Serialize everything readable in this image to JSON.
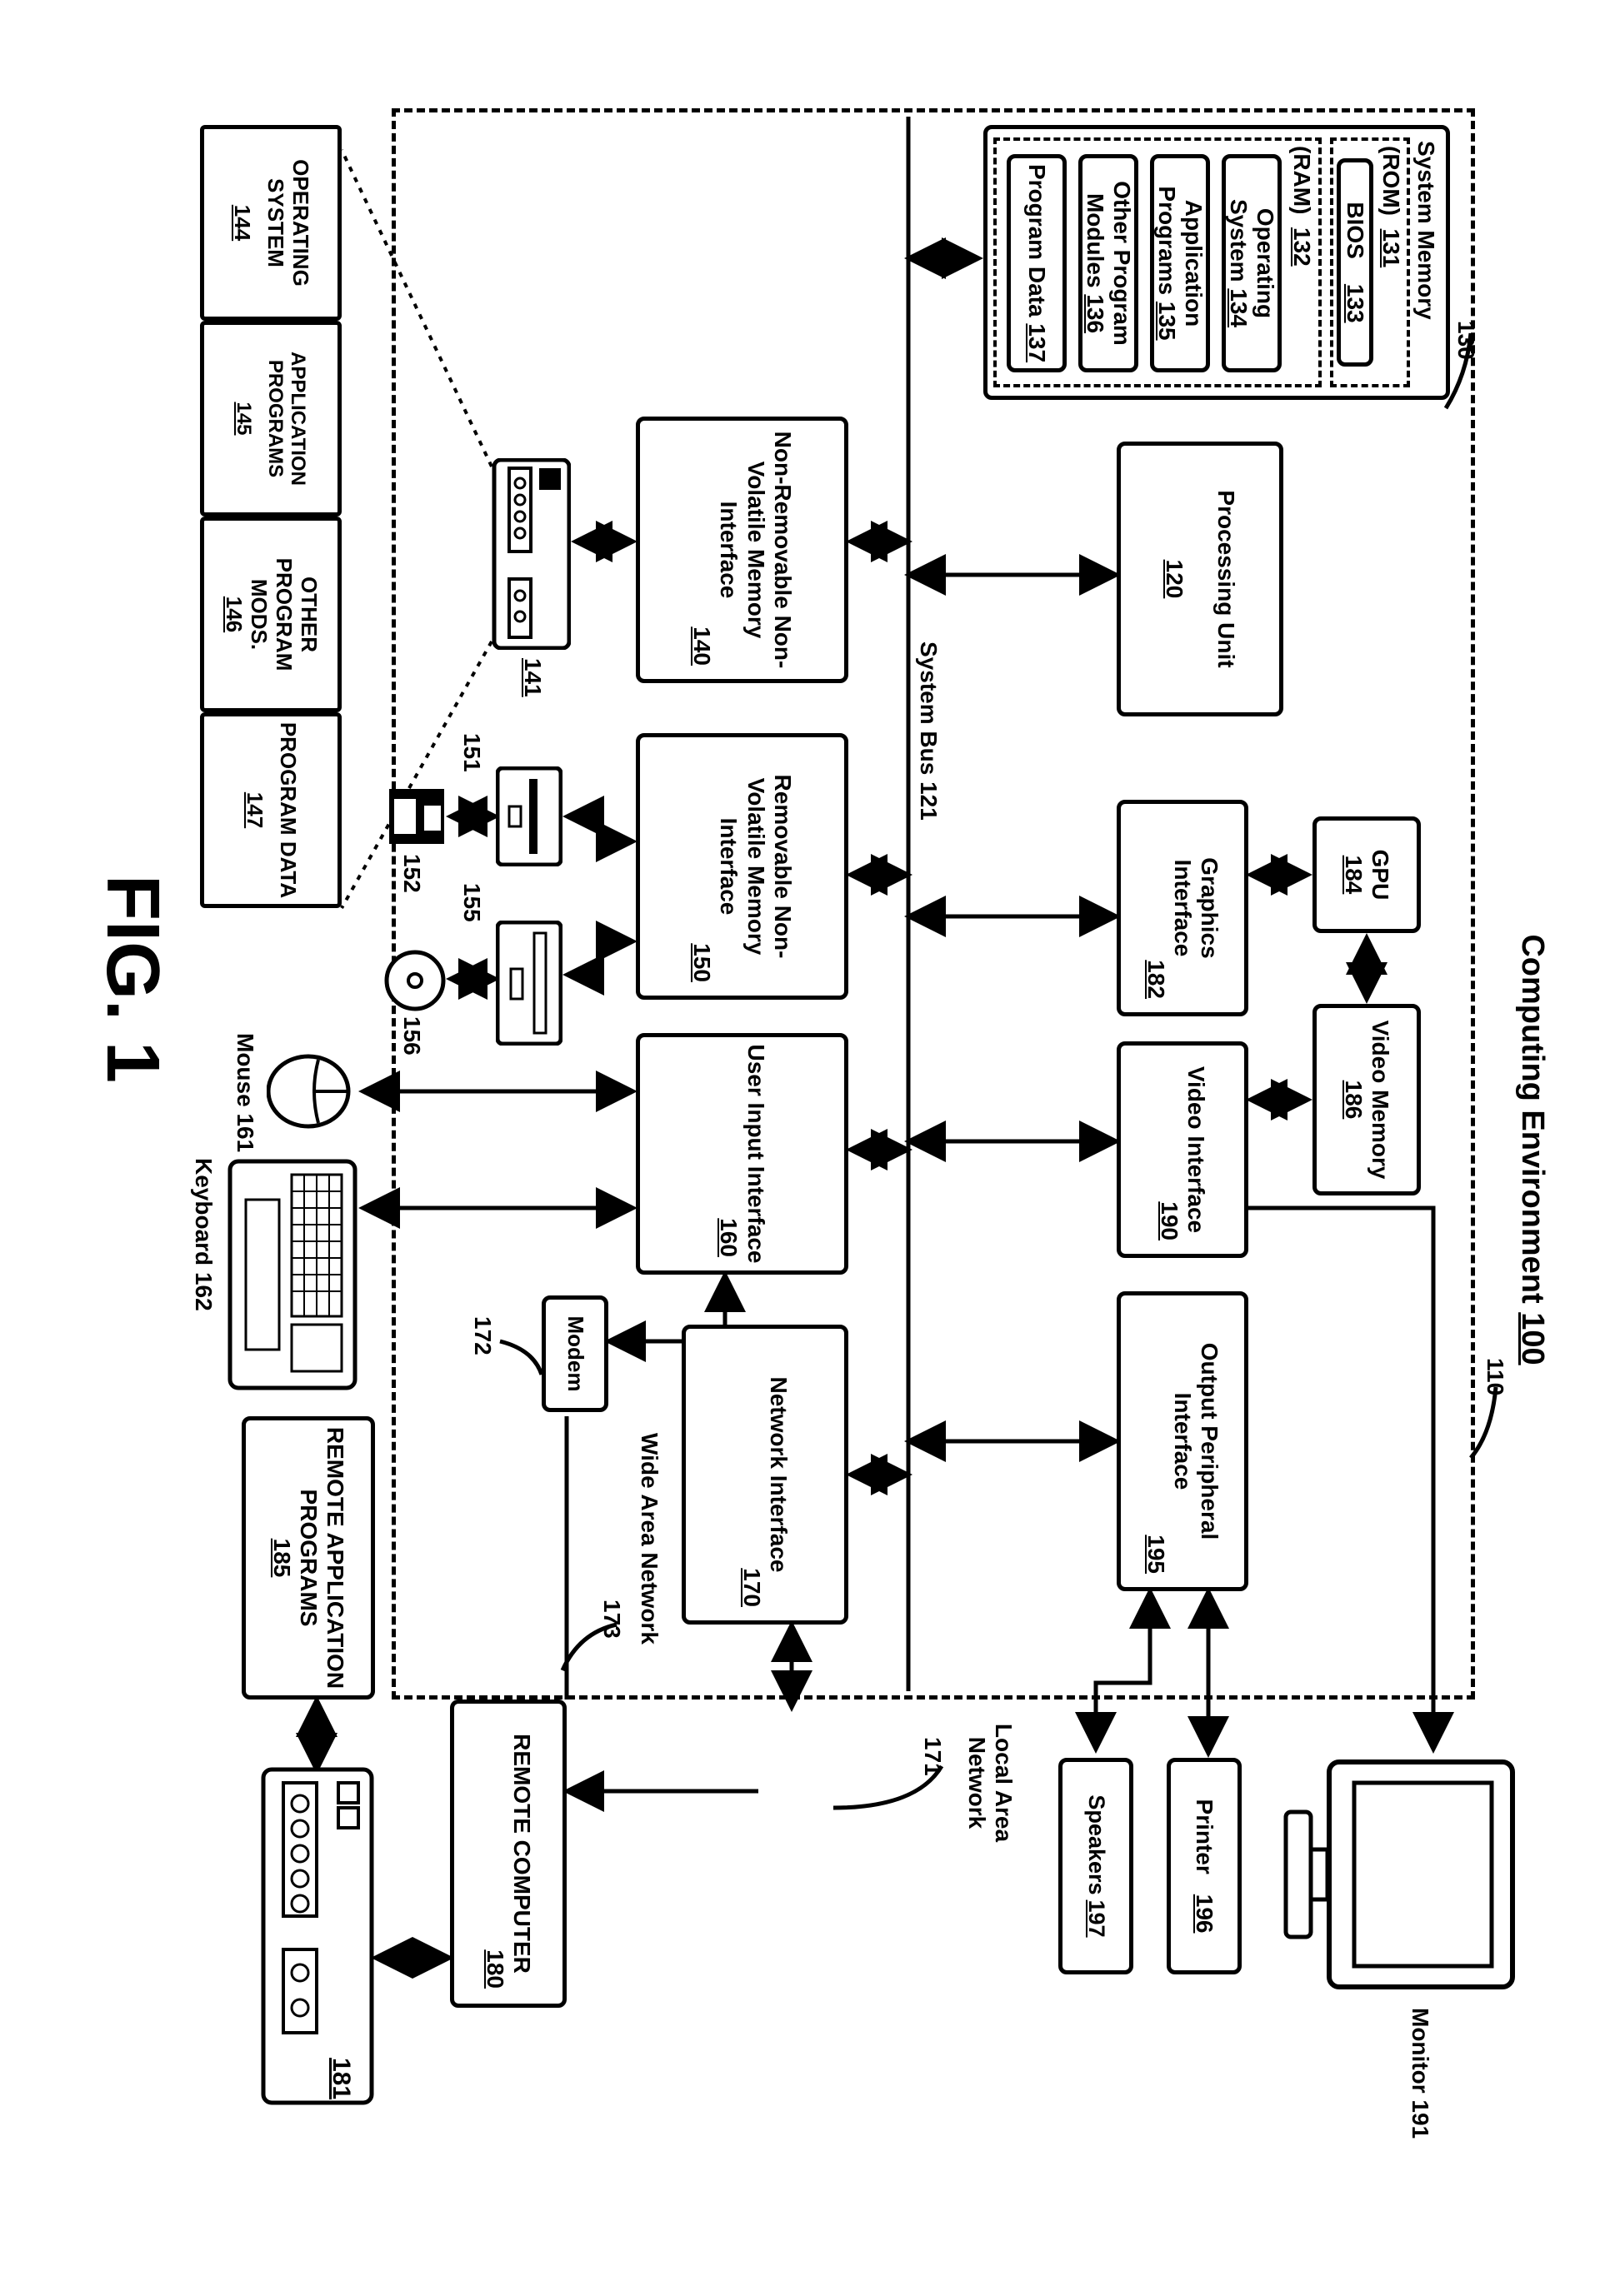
{
  "title": {
    "text": "Computing Environment",
    "ref": "100"
  },
  "fig": "FIG. 1",
  "dash_ref": "110",
  "sysmem": {
    "title": "System Memory",
    "ref": "130",
    "rom": {
      "label": "(ROM)",
      "ref": "131"
    },
    "bios": {
      "label": "BIOS",
      "ref": "133"
    },
    "ram": {
      "label": "(RAM)",
      "ref": "132"
    },
    "os": {
      "label": "Operating System",
      "ref": "134"
    },
    "apps": {
      "label": "Application Programs",
      "ref": "135"
    },
    "mods": {
      "label": "Other Program Modules",
      "ref": "136"
    },
    "data": {
      "label": "Program Data",
      "ref": "137"
    }
  },
  "proc": {
    "label": "Processing Unit",
    "ref": "120"
  },
  "gpu": {
    "label": "GPU",
    "ref": "184"
  },
  "vmem": {
    "label": "Video Memory",
    "ref": "186"
  },
  "gfx": {
    "label": "Graphics Interface",
    "ref": "182"
  },
  "vint": {
    "label": "Video Interface",
    "ref": "190"
  },
  "opi": {
    "label": "Output Peripheral Interface",
    "ref": "195"
  },
  "neti": {
    "label": "Network Interface",
    "ref": "170"
  },
  "uii": {
    "label": "User Input Interface",
    "ref": "160"
  },
  "rmi": {
    "label": "Removable Non-Volatile Memory Interface",
    "ref": "150"
  },
  "nrmi": {
    "label": "Non-Removable Non-Volatile Memory Interface",
    "ref": "140"
  },
  "sysbus": {
    "label": "System Bus",
    "ref": "121"
  },
  "monitor": {
    "label": "Monitor",
    "ref": "191"
  },
  "printer": {
    "label": "Printer",
    "ref": "196"
  },
  "speakers": {
    "label": "Speakers",
    "ref": "197"
  },
  "lan": {
    "label": "Local Area Network",
    "ref": "171"
  },
  "wan": {
    "label": "Wide Area Network",
    "ref": "173"
  },
  "modem": {
    "label": "Modem",
    "ref": "172"
  },
  "mouse": {
    "label": "Mouse",
    "ref": "161"
  },
  "keyboard": {
    "label": "Keyboard",
    "ref": "162"
  },
  "remote": {
    "label": "REMOTE COMPUTER",
    "ref": "180"
  },
  "remote_dev_ref": "181",
  "rap": {
    "label": "REMOTE APPLICATION PROGRAMS",
    "ref": "185"
  },
  "hdd_ref": "141",
  "floppy_drv_ref": "151",
  "floppy_ref": "152",
  "cddrv_ref": "155",
  "cd_ref": "156",
  "disk": {
    "os": {
      "label": "OPERATING SYSTEM",
      "ref": "144"
    },
    "apps": {
      "label": "APPLICATION PROGRAMS",
      "ref": "145"
    },
    "mods": {
      "label": "OTHER PROGRAM MODS.",
      "ref": "146"
    },
    "data": {
      "label": "PROGRAM DATA",
      "ref": "147"
    }
  }
}
